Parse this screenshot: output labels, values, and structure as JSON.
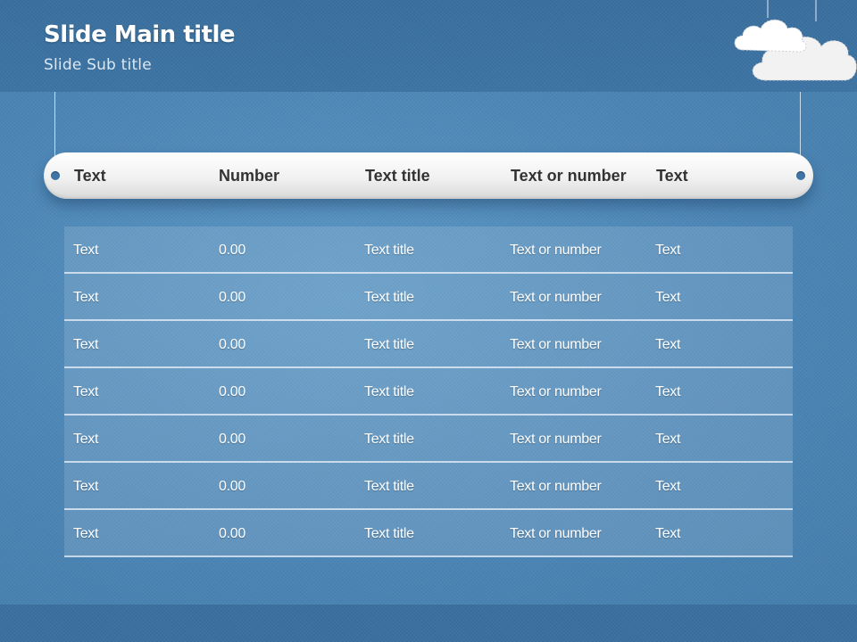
{
  "slide": {
    "title": "Slide Main title",
    "subtitle": "Slide Sub title"
  },
  "table": {
    "headers": [
      "Text",
      "Number",
      "Text title",
      "Text or number",
      "Text"
    ],
    "rows": [
      [
        "Text",
        "0.00",
        "Text title",
        "Text or number",
        "Text"
      ],
      [
        "Text",
        "0.00",
        "Text title",
        "Text or number",
        "Text"
      ],
      [
        "Text",
        "0.00",
        "Text title",
        "Text or number",
        "Text"
      ],
      [
        "Text",
        "0.00",
        "Text title",
        "Text or number",
        "Text"
      ],
      [
        "Text",
        "0.00",
        "Text title",
        "Text or number",
        "Text"
      ],
      [
        "Text",
        "0.00",
        "Text title",
        "Text or number",
        "Text"
      ],
      [
        "Text",
        "0.00",
        "Text title",
        "Text or number",
        "Text"
      ]
    ]
  },
  "decor": {
    "icons": [
      "cloud-icon",
      "cloud-icon"
    ],
    "colors": {
      "background": "#4d86b5",
      "header_band": "#3a6f9e",
      "table_header_text": "#333333",
      "cell_text": "#ffffff"
    }
  }
}
